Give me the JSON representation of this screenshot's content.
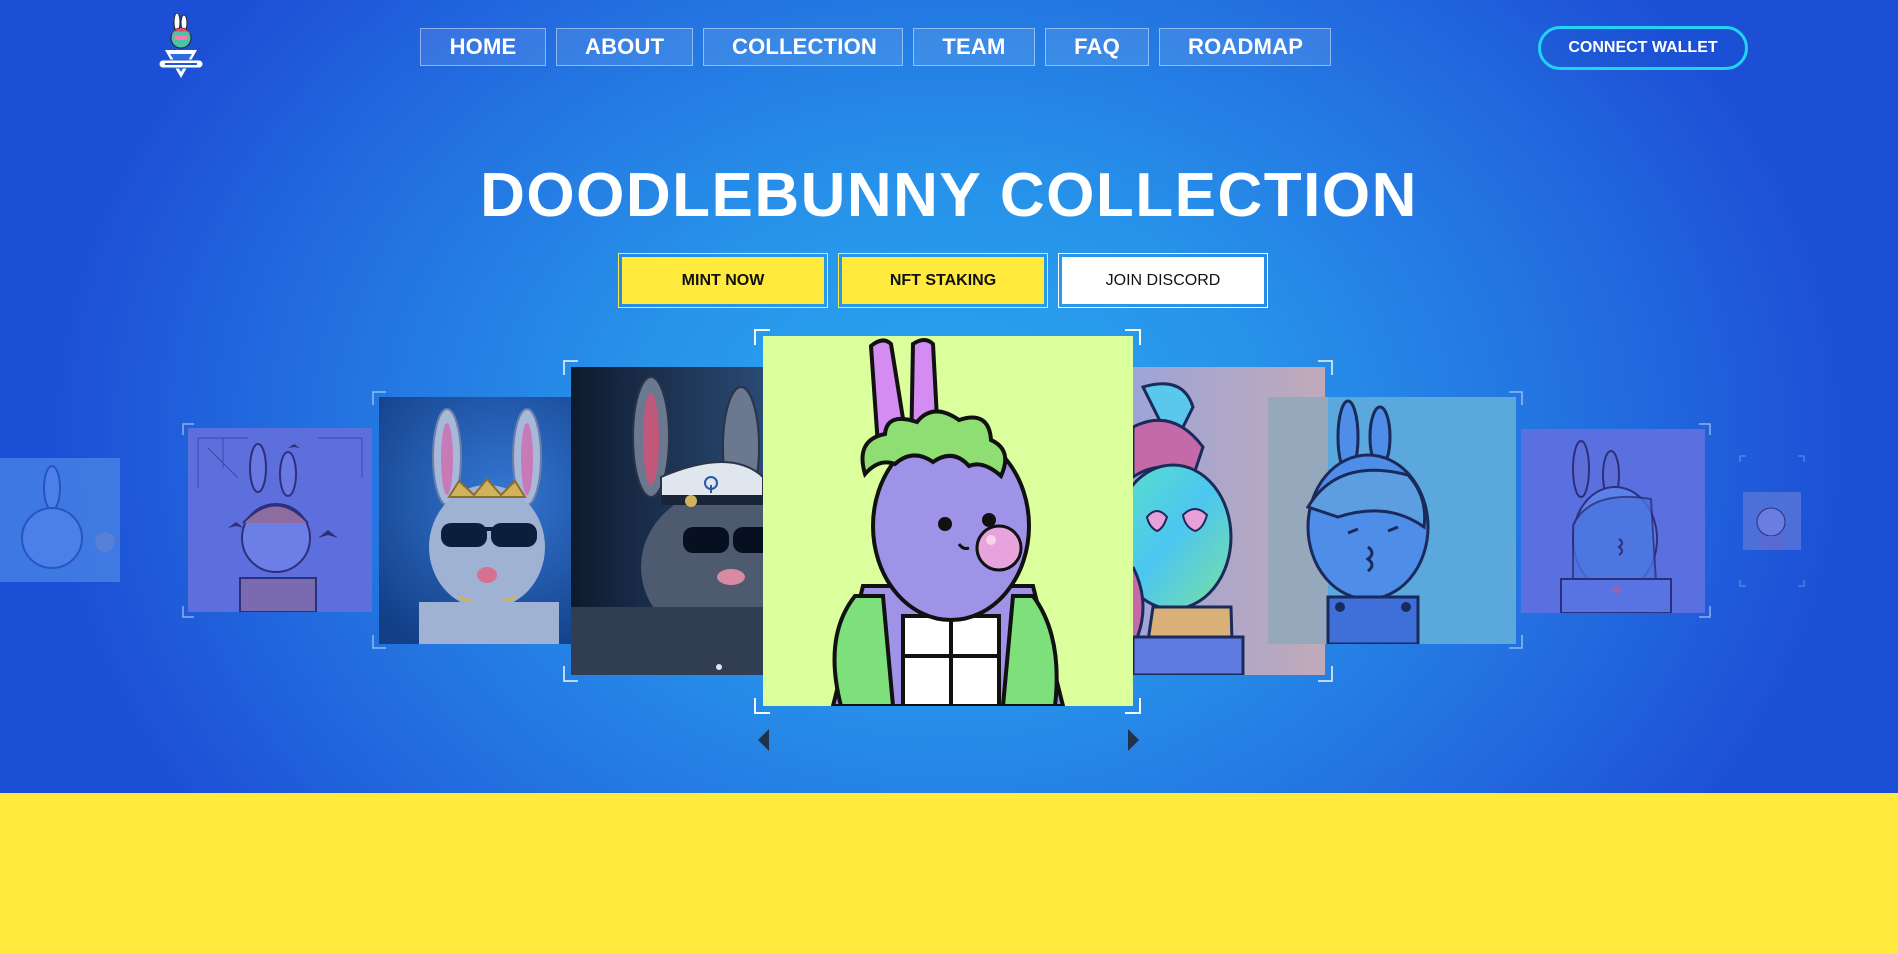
{
  "app": {
    "logo_icon": "doodlebunny-logo-icon"
  },
  "nav": {
    "items": [
      {
        "label": "HOME"
      },
      {
        "label": "ABOUT"
      },
      {
        "label": "COLLECTION"
      },
      {
        "label": "TEAM"
      },
      {
        "label": "FAQ"
      },
      {
        "label": "ROADMAP"
      }
    ],
    "connect_label": "CONNECT WALLET"
  },
  "hero": {
    "title": "DOODLEBUNNY COLLECTION",
    "buttons": [
      {
        "label": "MINT NOW"
      },
      {
        "label": "NFT STAKING"
      },
      {
        "label": "JOIN DISCORD"
      }
    ]
  },
  "carousel": {
    "prev_icon": "arrow-left-icon",
    "next_icon": "arrow-right-icon"
  },
  "colors": {
    "accent_yellow": "#ffea3d",
    "accent_cyan": "#22d3f5",
    "hero_blue": "#2793ea",
    "featured_bg": "#dcff9e"
  }
}
